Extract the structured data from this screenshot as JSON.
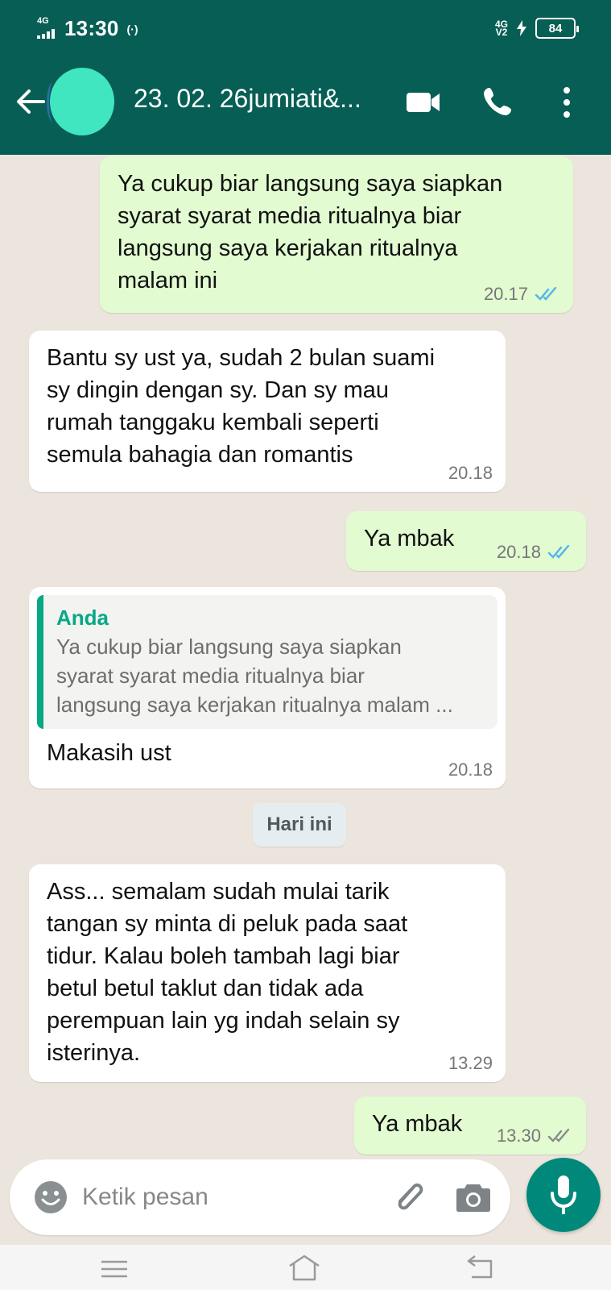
{
  "status_bar": {
    "network_left": "4G",
    "time": "13:30",
    "network_right": "4G",
    "battery": "84"
  },
  "header": {
    "title": "23. 02. 26jumiati&...",
    "icons": [
      "back-arrow-icon",
      "video-call-icon",
      "voice-call-icon",
      "more-options-icon"
    ]
  },
  "messages": [
    {
      "direction": "out",
      "text": "Ya cukup biar langsung saya siapkan\nsyarat syarat media ritualnya biar\nlangsung saya kerjakan ritualnya\nmalam ini",
      "time": "20.17",
      "read": true
    },
    {
      "direction": "in",
      "text": "Bantu sy ust ya, sudah 2 bulan suami\nsy dingin dengan sy. Dan sy mau\nrumah tanggaku kembali seperti\nsemula bahagia dan romantis",
      "time": "20.18"
    },
    {
      "direction": "out",
      "text": "Ya mbak",
      "time": "20.18",
      "read": true
    },
    {
      "direction": "in",
      "quote_author": "Anda",
      "quote_text": "Ya cukup biar langsung saya siapkan\nsyarat syarat media ritualnya biar\nlangsung saya kerjakan ritualnya malam ...",
      "text": "Makasih ust",
      "time": "20.18"
    },
    {
      "direction": "in",
      "text": "Ass... semalam sudah mulai tarik\ntangan sy minta di peluk pada saat\ntidur. Kalau boleh tambah lagi biar\nbetul betul taklut dan tidak ada\nperempuan lain yg indah selain sy\nisterinya.",
      "time": "13.29"
    },
    {
      "direction": "out",
      "text": "Ya mbak",
      "time": "13.30",
      "read": false
    }
  ],
  "day_separator": "Hari ini",
  "composer": {
    "placeholder": "Ketik pesan",
    "icons": [
      "emoji-icon",
      "attach-icon",
      "camera-icon",
      "mic-icon"
    ]
  },
  "colors": {
    "header": "#075e54",
    "outgoing_bubble": "#e2fbd1",
    "incoming_bubble": "#ffffff",
    "read_tick": "#4fb6ec",
    "mic_button": "#00897b",
    "quote_accent": "#08a884"
  }
}
